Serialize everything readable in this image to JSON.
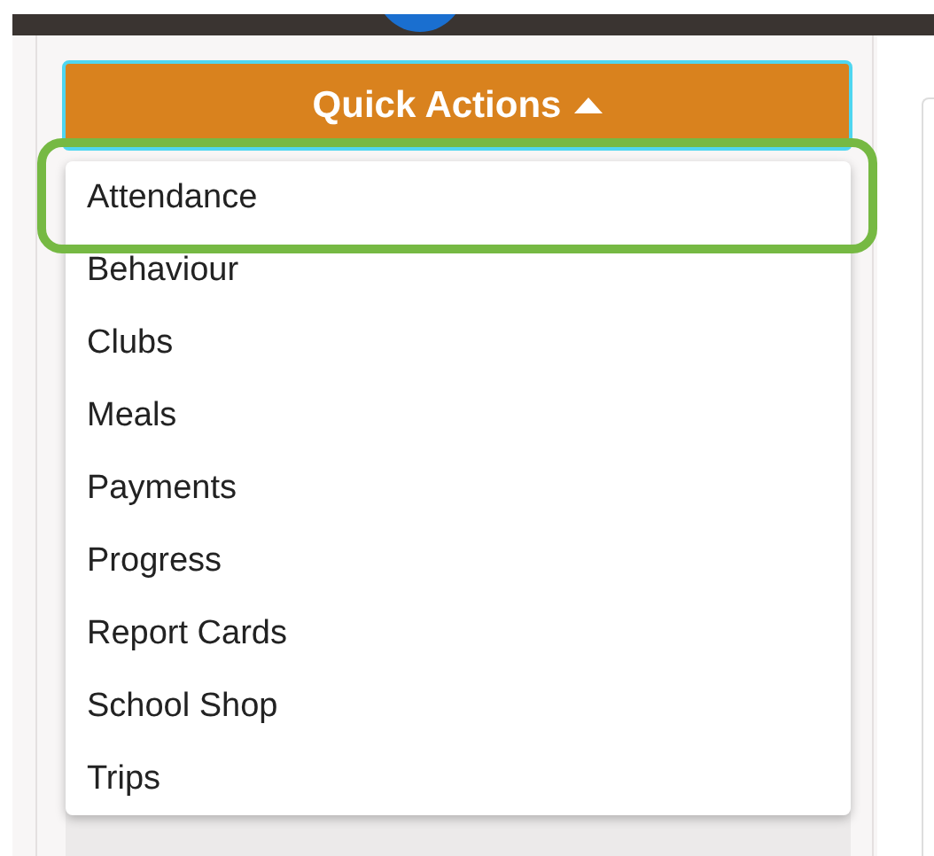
{
  "quick_actions": {
    "label": "Quick Actions",
    "expanded": true
  },
  "menu": [
    {
      "label": "Attendance",
      "highlighted": true
    },
    {
      "label": "Behaviour",
      "highlighted": false
    },
    {
      "label": "Clubs",
      "highlighted": false
    },
    {
      "label": "Meals",
      "highlighted": false
    },
    {
      "label": "Payments",
      "highlighted": false
    },
    {
      "label": "Progress",
      "highlighted": false
    },
    {
      "label": "Report Cards",
      "highlighted": false
    },
    {
      "label": "School Shop",
      "highlighted": false
    },
    {
      "label": "Trips",
      "highlighted": false
    }
  ]
}
